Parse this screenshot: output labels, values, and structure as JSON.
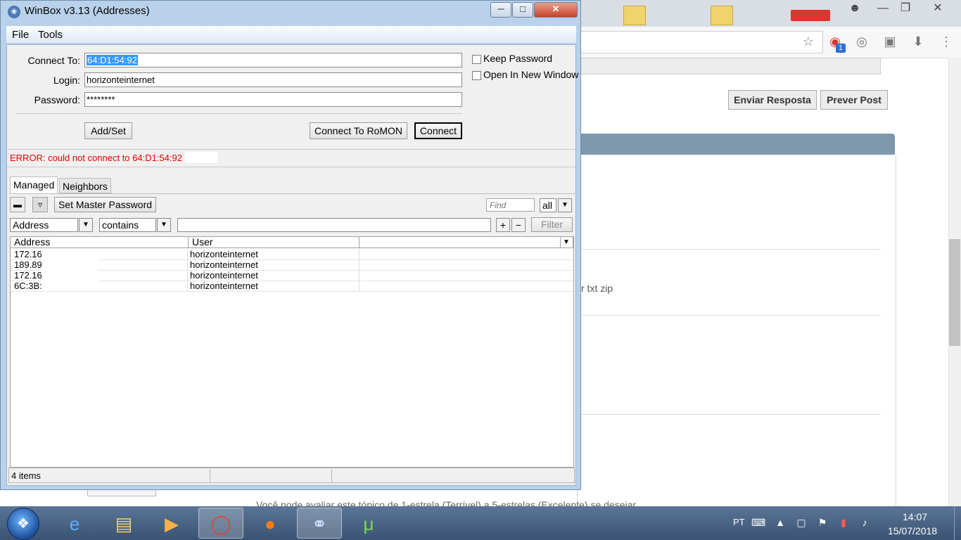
{
  "browser": {
    "tabs": [
      "",
      ""
    ],
    "forum_buttons": [
      "Enviar Resposta",
      "Prever Post"
    ],
    "visible_fragment": "r txt zip",
    "footer_text": "Você pode avaliar este tópico de 1-estrela (Terrível) a 5-estrelas (Excelente) se desejar.",
    "badge_count": "1"
  },
  "winbox": {
    "title": "WinBox v3.13 (Addresses)",
    "menu": [
      "File",
      "Tools"
    ],
    "connect_to_label": "Connect To:",
    "connect_to_value": "64:D1:54:92",
    "login_label": "Login:",
    "login_value": "horizonteinternet",
    "password_label": "Password:",
    "password_value": "********",
    "keep_password": "Keep Password",
    "open_new_window": "Open In New Window",
    "add_set": "Add/Set",
    "connect_romon": "Connect To RoMON",
    "connect": "Connect",
    "error": "ERROR: could not connect to 64:D1:54:92",
    "tabs": [
      "Managed",
      "Neighbors"
    ],
    "set_master_password": "Set Master Password",
    "find_placeholder": "Find",
    "all_option": "all",
    "filter_field": "Address",
    "filter_op": "contains",
    "filter_button": "Filter",
    "columns": [
      "Address",
      "User"
    ],
    "rows": [
      {
        "address": "172.16",
        "user": "horizonteinternet"
      },
      {
        "address": "189.89",
        "user": "horizonteinternet"
      },
      {
        "address": "172.16",
        "user": "horizonteinternet"
      },
      {
        "address": "6C:3B:",
        "user": "horizonteinternet"
      }
    ],
    "status": "4 items"
  },
  "taskbar": {
    "language": "PT",
    "time": "14:07",
    "date": "15/07/2018"
  },
  "colors": {
    "error": "#e00000",
    "selection": "#3399ff",
    "window_frame": "#b9d1ea",
    "forum_bar": "#7e98ae"
  }
}
